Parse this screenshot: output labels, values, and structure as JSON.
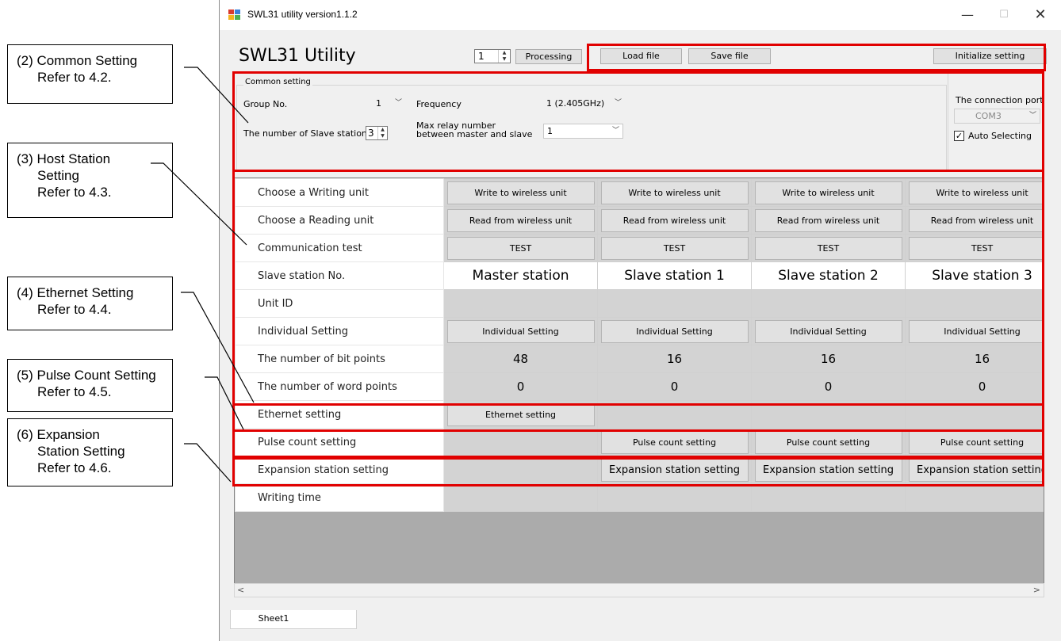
{
  "window": {
    "title": "SWL31 utility version1.1.2",
    "minimize_glyph": "—",
    "maximize_glyph": "☐",
    "close_glyph": "✕"
  },
  "app": {
    "heading": "SWL31 Utility",
    "processing_count": "1",
    "processing_label": "Processing",
    "load_label": "Load file",
    "save_label": "Save file",
    "initialize_label": "Initialize setting"
  },
  "common_setting": {
    "title": "Common setting",
    "group_label": "Group No.",
    "group_value": "1",
    "frequency_label": "Frequency",
    "frequency_value": "1 (2.405GHz)",
    "slaves_label": "The number of Slave stations",
    "slaves_value": "3",
    "relay_label_1": "Max relay number",
    "relay_label_2": "between master and slave",
    "relay_value": "1",
    "port_label": "The connection port",
    "port_value": "COM3",
    "auto_label": "Auto Selecting",
    "auto_checked": true
  },
  "grid": {
    "row_labels": {
      "writing": "Choose a Writing unit",
      "reading": "Choose a Reading unit",
      "comm_test": "Communication test",
      "slave_no": "Slave station No.",
      "unit_id": "Unit ID",
      "individual": "Individual Setting",
      "bit_points": "The number of bit points",
      "word_points": "The number of word points",
      "ethernet": "Ethernet setting",
      "pulse": "Pulse count setting",
      "expansion": "Expansion station setting",
      "writing_time": "Writing time"
    },
    "write_btn": "Write to wireless unit",
    "read_btn": "Read from wireless unit",
    "test_btn": "TEST",
    "individual_btn": "Individual Setting",
    "ethernet_btn": "Ethernet setting",
    "pulse_btn": "Pulse count setting",
    "expansion_btn": "Expansion station setting",
    "stations": [
      "Master station",
      "Slave station 1",
      "Slave station 2",
      "Slave station 3"
    ],
    "bit_points": [
      "48",
      "16",
      "16",
      "16"
    ],
    "word_points": [
      "0",
      "0",
      "0",
      "0"
    ]
  },
  "sheet_tab": "Sheet1",
  "callouts": {
    "c2": [
      "(2) Common Setting",
      "Refer to 4.2."
    ],
    "c3": [
      "(3) Host Station",
      "Setting",
      "Refer to 4.3."
    ],
    "c4": [
      "(4) Ethernet Setting",
      "Refer to 4.4."
    ],
    "c5": [
      "(5) Pulse Count Setting",
      "Refer to 4.5."
    ],
    "c6": [
      "(6) Expansion",
      "Station Setting",
      "Refer to 4.6."
    ]
  },
  "colors": {
    "highlight": "#e10000",
    "window_bg": "#f0f0f0",
    "cell_gray": "#d3d3d3"
  }
}
